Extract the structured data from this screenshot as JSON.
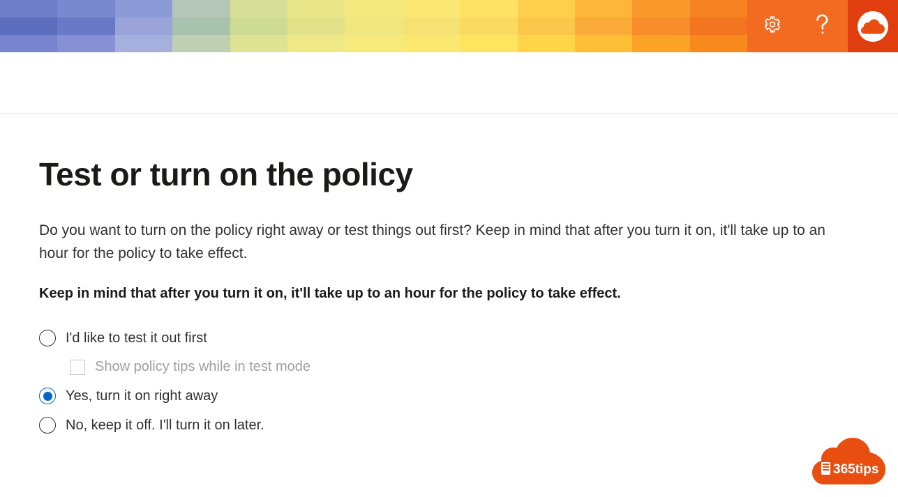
{
  "header": {
    "icons": {
      "settings": "gear-icon",
      "help": "help-icon",
      "profile": "profile-cloud-icon"
    }
  },
  "page": {
    "title": "Test or turn on the policy",
    "description": "Do you want to turn on the policy right away or test things out first? Keep in mind that after you turn it on, it'll take up to an hour for the policy to take effect.",
    "note": "Keep in mind that after you turn it on, it'll take up to an hour for the policy to take effect."
  },
  "options": {
    "test": {
      "label": "I'd like to test it out first",
      "selected": false,
      "sub": {
        "label": "Show policy tips while in test mode",
        "checked": false
      }
    },
    "on": {
      "label": "Yes, turn it on right away",
      "selected": true
    },
    "off": {
      "label": "No, keep it off. I'll turn it on later.",
      "selected": false
    }
  },
  "branding": {
    "watermark_text": "365tips"
  },
  "colors": {
    "accent": "#0067c5",
    "header_orange": "#f26b21",
    "header_red": "#e03e0e"
  }
}
